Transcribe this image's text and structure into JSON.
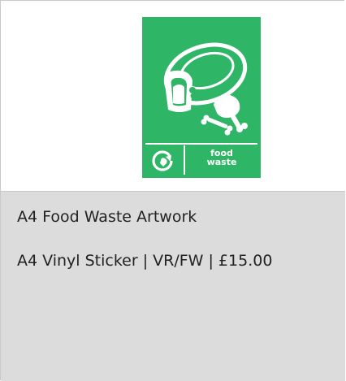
{
  "product": {
    "title": "A4 Food Waste Artwork",
    "meta": "A4 Vinyl Sticker | VR/FW  | £15.00"
  },
  "poster": {
    "label_line1": "food",
    "label_line2": "waste",
    "background_color": "#2fb566",
    "icons": [
      "food-waste-illustration",
      "recycle-icon"
    ]
  },
  "colors": {
    "info_background": "#dcdcdc",
    "border": "#c9c9c9"
  }
}
